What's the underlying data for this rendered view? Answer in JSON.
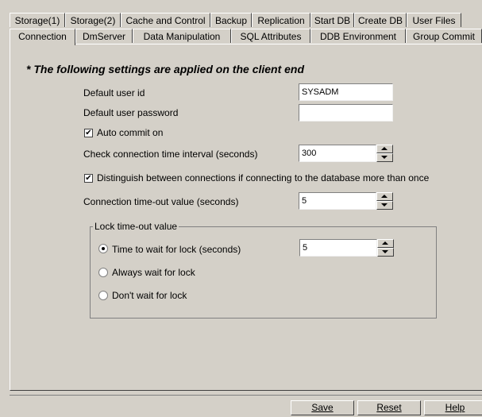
{
  "tabs_row1": [
    "Storage(1)",
    "Storage(2)",
    "Cache and Control",
    "Backup",
    "Replication",
    "Start DB",
    "Create DB",
    "User Files"
  ],
  "tabs_row2": [
    "Connection",
    "DmServer",
    "Data Manipulation",
    "SQL Attributes",
    "DDB Environment",
    "Group Commit"
  ],
  "active_tab": "Connection",
  "heading": "* The following settings are applied on the client end",
  "fields": {
    "default_user_id": {
      "label": "Default user id",
      "value": "SYSADM"
    },
    "default_user_password": {
      "label": "Default user password",
      "value": ""
    },
    "auto_commit": {
      "label": "Auto commit on",
      "checked": true
    },
    "check_interval": {
      "label": "Check connection time interval (seconds)",
      "value": "300"
    },
    "distinguish": {
      "label": "Distinguish between connections if connecting to the database more than once",
      "checked": true
    },
    "timeout": {
      "label": "Connection time-out value (seconds)",
      "value": "5"
    }
  },
  "lock_group": {
    "title": "Lock time-out value",
    "options": [
      {
        "label": "Time to wait for lock (seconds)",
        "selected": true,
        "value": "5"
      },
      {
        "label": "Always wait for lock",
        "selected": false
      },
      {
        "label": "Don't wait for lock",
        "selected": false
      }
    ]
  },
  "buttons": {
    "save": "Save",
    "reset": "Reset",
    "help": "Help"
  }
}
